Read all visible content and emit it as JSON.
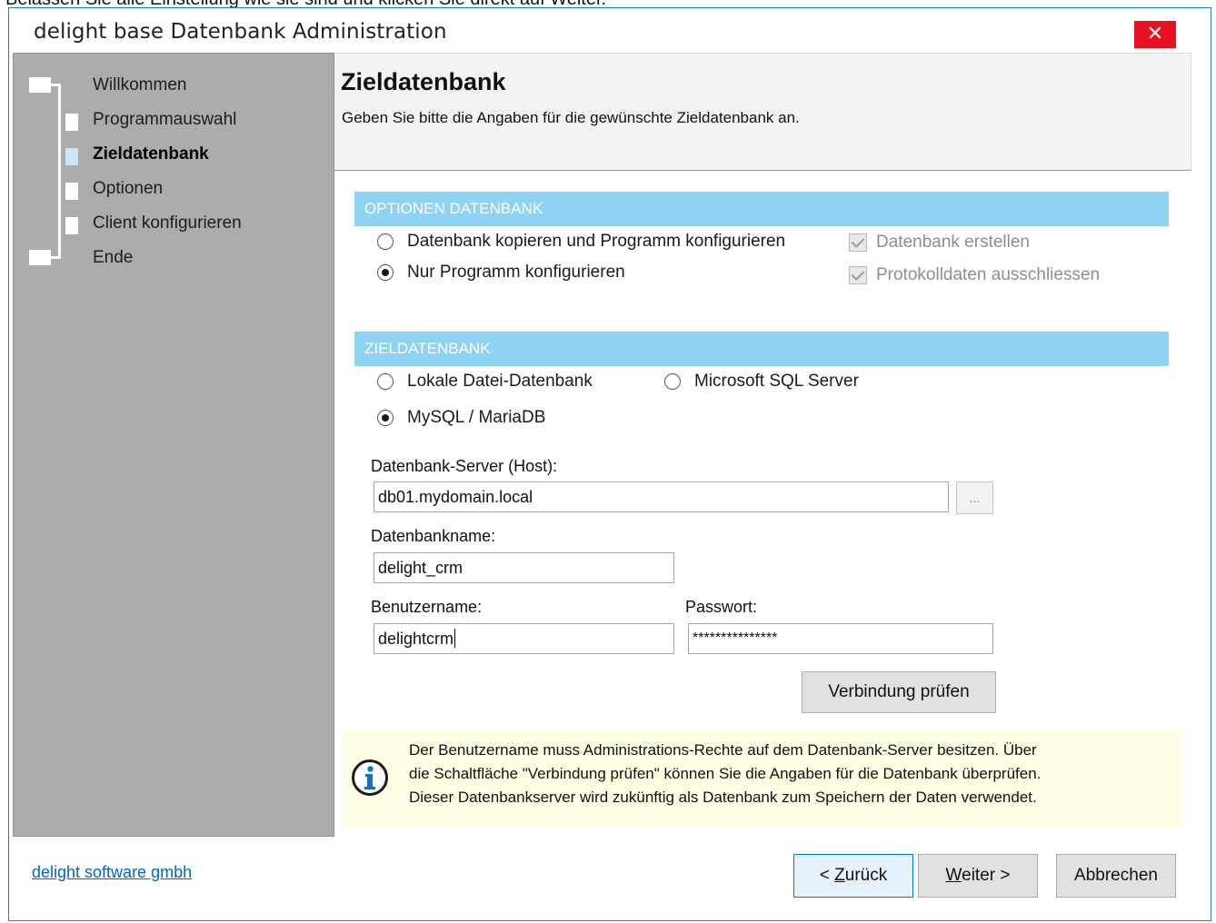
{
  "caption": "Belassen Sie alle Einstellung wie sie sind und klicken Sie direkt auf Weiter.",
  "window": {
    "title": "delight base Datenbank Administration",
    "close_glyph": "✕"
  },
  "wizard": {
    "steps": [
      {
        "label": "Willkommen",
        "active": false
      },
      {
        "label": "Programmauswahl",
        "active": false
      },
      {
        "label": "Zieldatenbank",
        "active": true
      },
      {
        "label": "Optionen",
        "active": false
      },
      {
        "label": "Client konfigurieren",
        "active": false
      },
      {
        "label": "Ende",
        "active": false
      }
    ]
  },
  "header": {
    "title": "Zieldatenbank",
    "subtitle": "Geben Sie bitte die Angaben für die gewünschte Zieldatenbank an."
  },
  "options_section": {
    "title": "OPTIONEN DATENBANK",
    "radios": [
      {
        "label": "Datenbank kopieren und Programm konfigurieren",
        "selected": false
      },
      {
        "label": "Nur Programm konfigurieren",
        "selected": true
      }
    ],
    "checks": [
      {
        "label": "Datenbank erstellen",
        "checked": true,
        "disabled": true
      },
      {
        "label": "Protokolldaten ausschliessen",
        "checked": true,
        "disabled": true
      }
    ]
  },
  "target_section": {
    "title": "ZIELDATENBANK",
    "radios": [
      {
        "label": "Lokale Datei-Datenbank",
        "selected": false
      },
      {
        "label": "Microsoft SQL Server",
        "selected": false
      },
      {
        "label": "MySQL / MariaDB",
        "selected": true
      }
    ]
  },
  "form": {
    "host_label": "Datenbank-Server (Host):",
    "host_value": "db01.mydomain.local",
    "browse_label": "...",
    "dbname_label": "Datenbankname:",
    "dbname_value": "delight_crm",
    "user_label": "Benutzername:",
    "user_value": "delightcrm",
    "password_label": "Passwort:",
    "password_value": "***************",
    "test_button": "Verbindung prüfen"
  },
  "info": {
    "icon": "info-icon",
    "lines": [
      "Der Benutzername muss Administrations-Rechte auf dem Datenbank-Server besitzen. Über",
      "die Schaltfläche \"Verbindung prüfen\" können Sie die Angaben für die Datenbank überprüfen.",
      "Dieser Datenbankserver wird zukünftig als Datenbank zum Speichern der Daten verwendet."
    ]
  },
  "footer": {
    "company_link": "delight software gmbh",
    "back_prefix": "< ",
    "back_accel": "Z",
    "back_rest": "urück",
    "next_accel": "W",
    "next_rest": "eiter >",
    "cancel": "Abbrechen"
  }
}
